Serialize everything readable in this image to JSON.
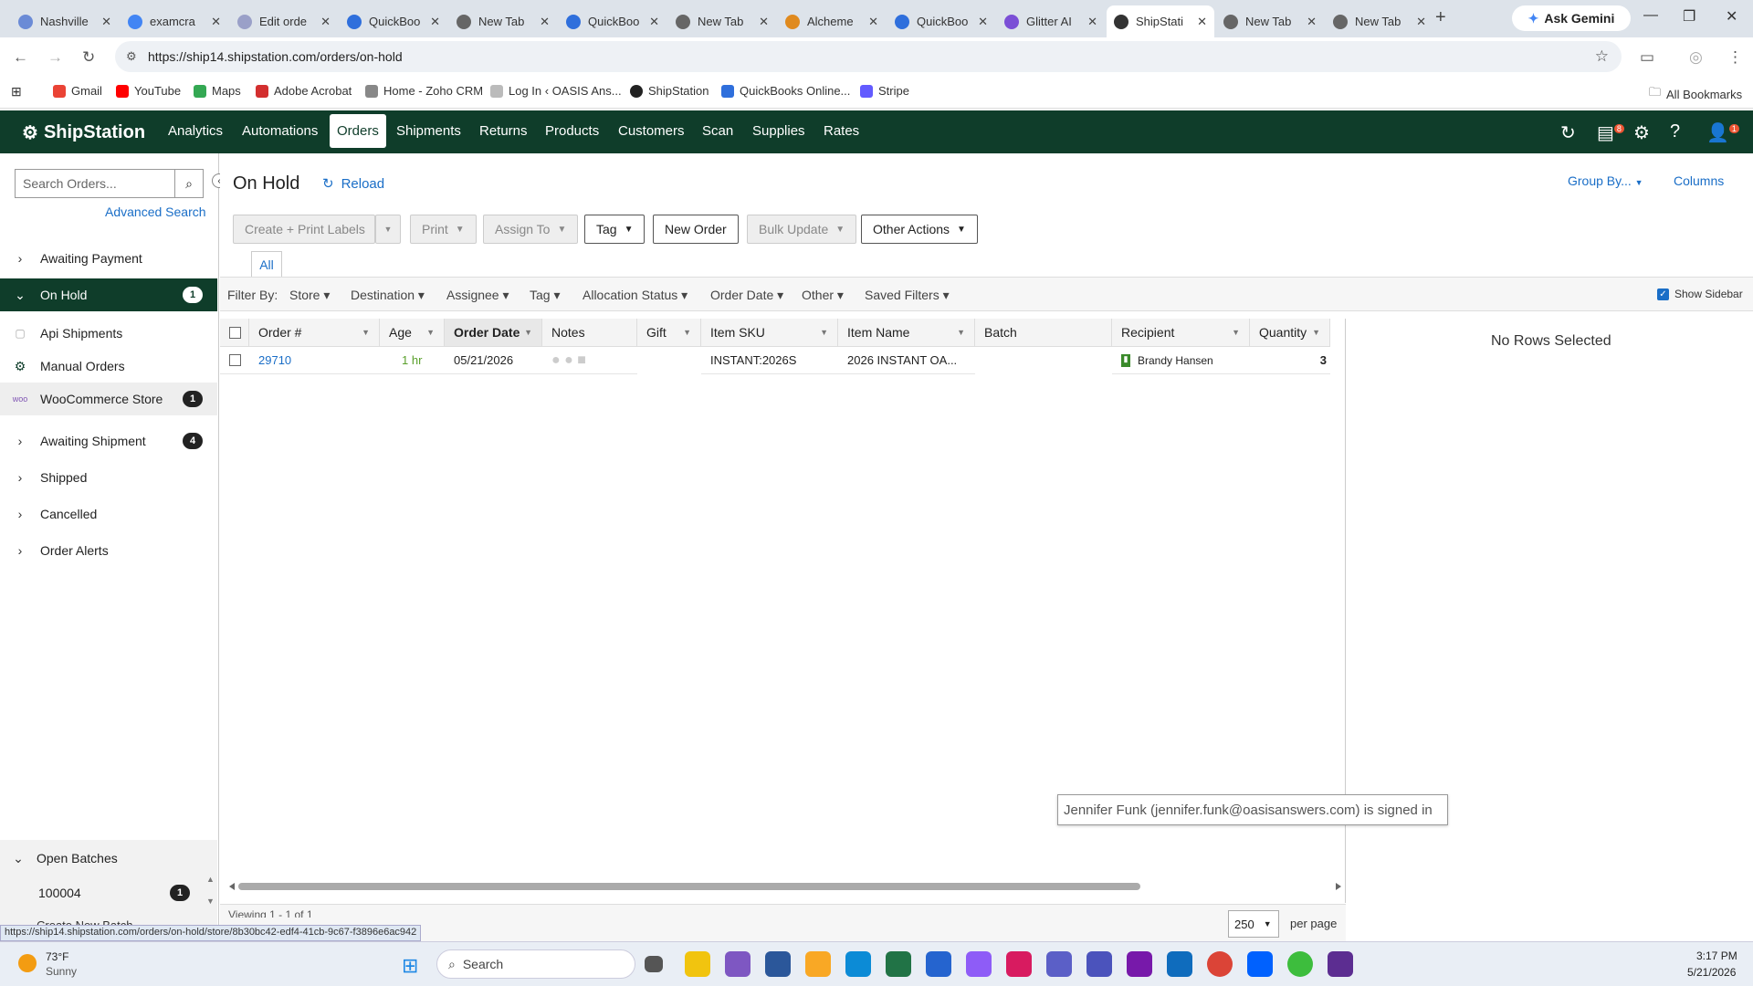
{
  "browser": {
    "tabs": [
      {
        "title": "Nashville",
        "color": "#6b8bd6"
      },
      {
        "title": "examcra",
        "color": "#4285f4"
      },
      {
        "title": "Edit orde",
        "color": "#9aa0c8"
      },
      {
        "title": "QuickBoo",
        "color": "#2f6fdc"
      },
      {
        "title": "New Tab",
        "color": "#666"
      },
      {
        "title": "QuickBoo",
        "color": "#2f6fdc"
      },
      {
        "title": "New Tab",
        "color": "#666"
      },
      {
        "title": "Alcheme",
        "color": "#e08a1e"
      },
      {
        "title": "QuickBoo",
        "color": "#2f6fdc"
      },
      {
        "title": "Glitter AI",
        "color": "#7b4fd6"
      },
      {
        "title": "ShipStati",
        "color": "#333"
      },
      {
        "title": "New Tab",
        "color": "#666"
      },
      {
        "title": "New Tab",
        "color": "#666"
      }
    ],
    "ask_gemini": "Ask Gemini",
    "url": "https://ship14.shipstation.com/orders/on-hold",
    "bookmarks": [
      "Gmail",
      "YouTube",
      "Maps",
      "Adobe Acrobat",
      "Home - Zoho CRM",
      "Log In ‹ OASIS Ans...",
      "ShipStation",
      "QuickBooks Online...",
      "Stripe"
    ],
    "all_bookmarks": "All Bookmarks",
    "status_url": "https://ship14.shipstation.com/orders/on-hold/store/8b30bc42-edf4-41cb-9c67-f3896e6ac942"
  },
  "app": {
    "logo": "ShipStation",
    "nav": [
      "Analytics",
      "Automations",
      "Orders",
      "Shipments",
      "Returns",
      "Products",
      "Customers",
      "Scan",
      "Supplies",
      "Rates"
    ],
    "active_nav": "Orders",
    "printer_badge": "8",
    "user_badge": "1"
  },
  "sidebar": {
    "search_placeholder": "Search Orders...",
    "advanced_search": "Advanced Search",
    "items": [
      {
        "label": "Awaiting Payment",
        "count": ""
      },
      {
        "label": "On Hold",
        "count": "1"
      },
      {
        "label": "Api Shipments",
        "count": ""
      },
      {
        "label": "Manual Orders",
        "count": ""
      },
      {
        "label": "WooCommerce Store",
        "count": "1"
      },
      {
        "label": "Awaiting Shipment",
        "count": "4"
      },
      {
        "label": "Shipped",
        "count": ""
      },
      {
        "label": "Cancelled",
        "count": ""
      },
      {
        "label": "Order Alerts",
        "count": ""
      }
    ],
    "open_batches": "Open Batches",
    "batch_id": "100004",
    "batch_count": "1",
    "create_batch": "Create New Batch"
  },
  "main": {
    "title": "On Hold",
    "reload": "Reload",
    "group_by": "Group By...",
    "columns": "Columns",
    "buttons": [
      "Create + Print Labels",
      "Print",
      "Assign To",
      "Tag",
      "New Order",
      "Bulk Update",
      "Other Actions"
    ],
    "all_tab": "All",
    "filter_by": "Filter By:",
    "filters": [
      "Store",
      "Destination",
      "Assignee",
      "Tag",
      "Allocation Status",
      "Order Date",
      "Other",
      "Saved Filters"
    ],
    "show_sidebar": "Show Sidebar",
    "headers": [
      "Order #",
      "Age",
      "Order Date",
      "Notes",
      "Gift",
      "Item SKU",
      "Item Name",
      "Batch",
      "Recipient",
      "Quantity"
    ],
    "row": {
      "order": "29710",
      "age": "1 hr",
      "date": "05/21/2026",
      "sku": "INSTANT:2026S",
      "name": "2026 INSTANT OA...",
      "recipient": "Brandy Hansen",
      "quantity": "3"
    },
    "no_rows": "No Rows Selected",
    "viewing": "Viewing 1 - 1 of 1",
    "per_page_value": "250",
    "per_page": "per page",
    "tooltip": "Jennifer Funk (jennifer.funk@oasisanswers.com) is signed in"
  },
  "taskbar": {
    "temp": "73°F",
    "weather": "Sunny",
    "search": "Search",
    "time": "3:17 PM",
    "date": "5/21/2026"
  }
}
